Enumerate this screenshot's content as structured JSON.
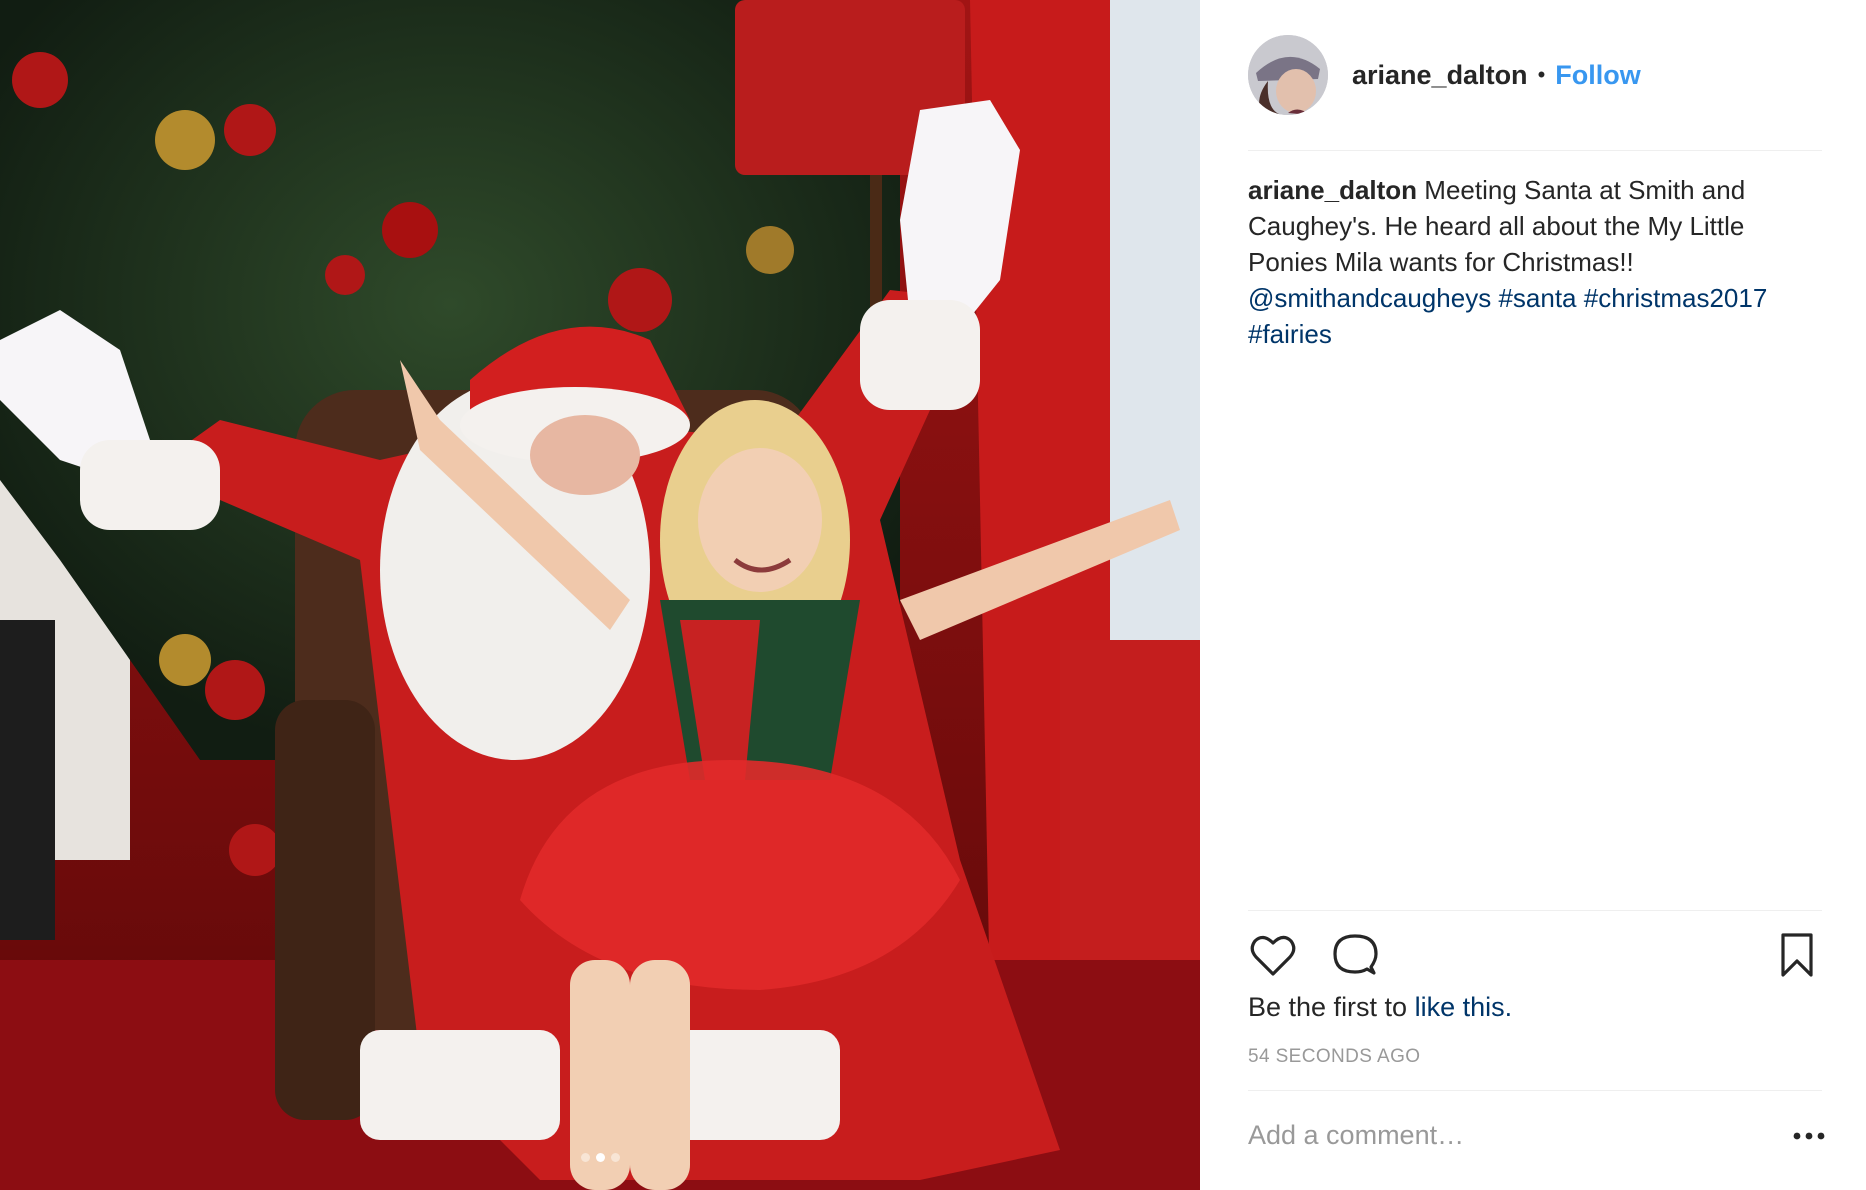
{
  "header": {
    "username": "ariane_dalton",
    "separator": "•",
    "follow_label": "Follow"
  },
  "caption": {
    "username": "ariane_dalton",
    "text": "Meeting Santa at Smith and Caughey's. He heard all about the My Little Ponies Mila wants for Christmas!!",
    "mention": "@smithandcaugheys",
    "hashtags": [
      "#santa",
      "#christmas2017",
      "#fairies"
    ]
  },
  "actions": {
    "icons": [
      "heart-icon",
      "comment-icon",
      "bookmark-icon"
    ]
  },
  "likes": {
    "prefix": "Be the first to",
    "link": "like this."
  },
  "timestamp": "54 SECONDS AGO",
  "comment_box": {
    "placeholder": "Add a comment…"
  },
  "carousel": {
    "total": 3,
    "active_index": 2
  },
  "colors": {
    "accent": "#3897f0",
    "link": "#003569",
    "muted": "#999999",
    "text": "#262626"
  }
}
